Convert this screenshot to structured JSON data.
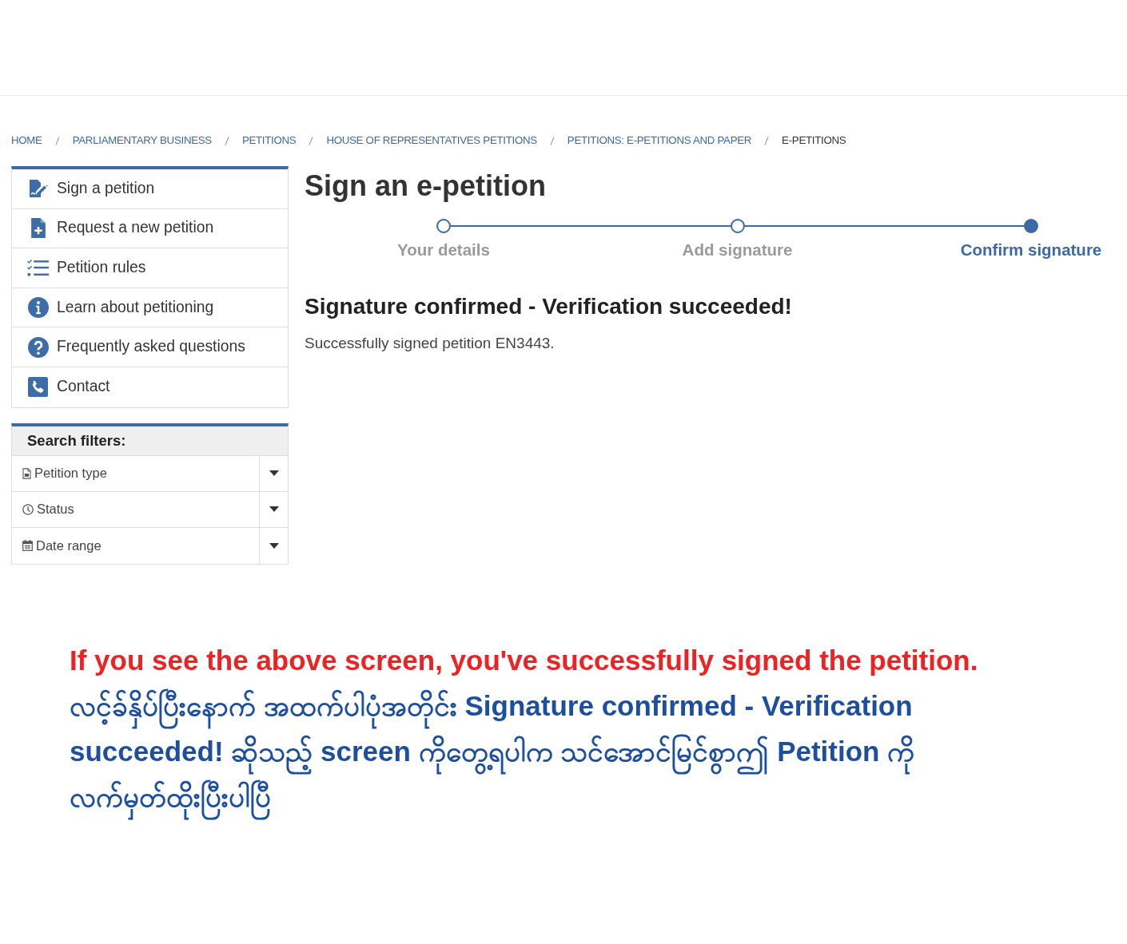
{
  "breadcrumb": [
    {
      "label": "HOME",
      "current": false
    },
    {
      "label": "PARLIAMENTARY BUSINESS",
      "current": false
    },
    {
      "label": "PETITIONS",
      "current": false
    },
    {
      "label": "HOUSE OF REPRESENTATIVES PETITIONS",
      "current": false
    },
    {
      "label": "PETITIONS: E-PETITIONS AND PAPER",
      "current": false
    },
    {
      "label": "E-PETITIONS",
      "current": true
    }
  ],
  "sidebar": {
    "menu": [
      {
        "label": "Sign a petition"
      },
      {
        "label": "Request a new petition"
      },
      {
        "label": "Petition rules"
      },
      {
        "label": "Learn about petitioning"
      },
      {
        "label": "Frequently asked questions"
      },
      {
        "label": "Contact"
      }
    ],
    "filters": {
      "title": "Search filters:",
      "items": [
        {
          "label": "Petition type",
          "expanded": false
        },
        {
          "label": "Status",
          "expanded": false
        },
        {
          "label": "Date range",
          "expanded": false
        }
      ]
    }
  },
  "main": {
    "title": "Sign an e-petition",
    "steps": [
      {
        "label": "Your details",
        "selected": false
      },
      {
        "label": "Add signature",
        "selected": false
      },
      {
        "label": "Confirm signature",
        "selected": true
      }
    ],
    "heading": "Signature confirmed - Verification succeeded!",
    "message": "Successfully signed petition EN3443."
  },
  "notice": {
    "english": "If you see the above screen, you've successfully signed the petition.",
    "burmese": "လင့်ခ်နှိပ်ပြီးနောက် အထက်ပါပုံအတိုင်း Signature confirmed - Verification succeeded! ဆိုသည့် screen ကိုတွေ့ရပါက သင်အောင်မြင်စွာဤ Petition ကို လက်မှတ်ထိုးပြီးပါပြီ"
  }
}
